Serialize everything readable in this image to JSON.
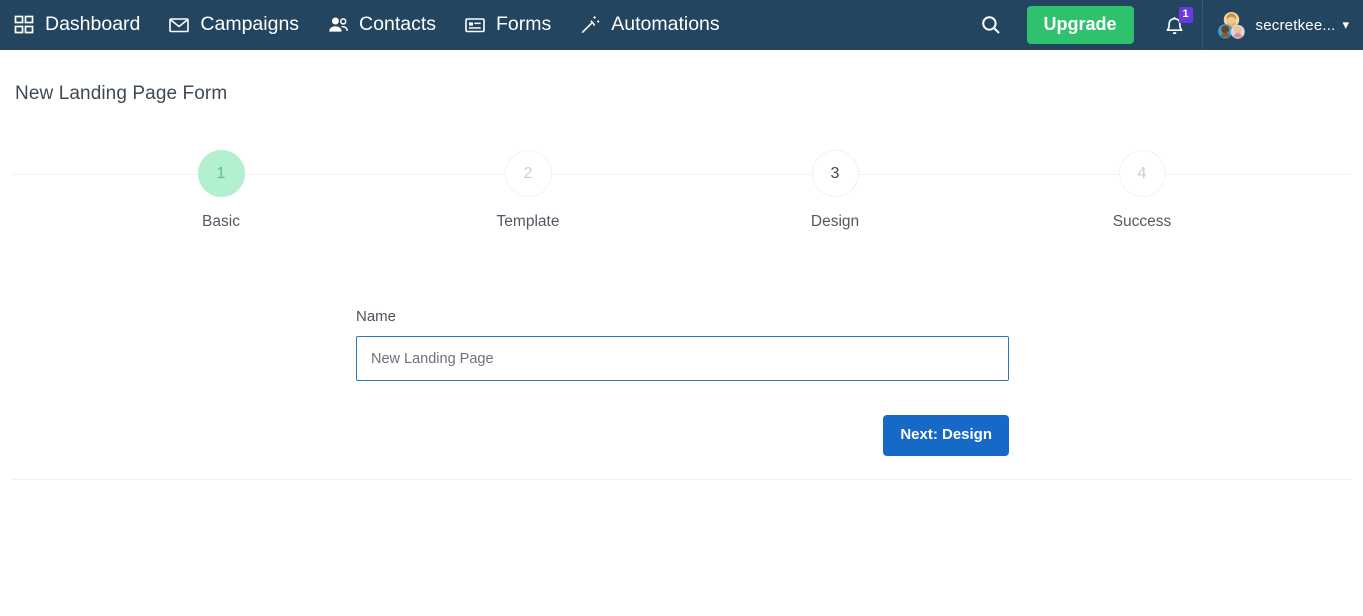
{
  "navbar": {
    "items": [
      {
        "label": "Dashboard",
        "icon": "grid-icon"
      },
      {
        "label": "Campaigns",
        "icon": "envelope-icon"
      },
      {
        "label": "Contacts",
        "icon": "people-icon"
      },
      {
        "label": "Forms",
        "icon": "form-card-icon"
      },
      {
        "label": "Automations",
        "icon": "magic-wand-icon"
      }
    ],
    "search_icon": "search-icon",
    "upgrade_label": "Upgrade",
    "notifications": {
      "icon": "bell-icon",
      "count": "1",
      "badge_color": "#6a3ae0"
    },
    "user": {
      "name": "secretkee...",
      "avatar_icon": "group-avatar-icon",
      "caret_icon": "chevron-down-icon"
    },
    "bg_color": "#23455f",
    "upgrade_color": "#2ec26e"
  },
  "page": {
    "title": "New Landing Page Form"
  },
  "stepper": {
    "steps": [
      {
        "number": "1",
        "label": "Basic",
        "state": "active"
      },
      {
        "number": "2",
        "label": "Template",
        "state": "upcoming"
      },
      {
        "number": "3",
        "label": "Design",
        "state": "dark-num"
      },
      {
        "number": "4",
        "label": "Success",
        "state": "upcoming"
      }
    ],
    "active_fill": "#b2f0d0",
    "active_text": "#54c58c"
  },
  "form": {
    "name_label": "Name",
    "name_value": "New Landing Page",
    "name_placeholder": "New Landing Page",
    "next_label": "Next: Design",
    "next_color": "#1769c8",
    "input_border_color": "#2a7ab9"
  }
}
